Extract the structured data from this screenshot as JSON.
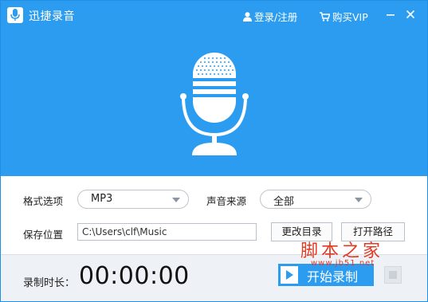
{
  "app": {
    "title": "迅捷录音"
  },
  "header": {
    "login_label": "登录/注册",
    "vip_label": "购买VIP"
  },
  "settings": {
    "format_label": "格式选项",
    "format_value": "MP3",
    "source_label": "声音来源",
    "source_value": "全部",
    "save_label": "保存位置",
    "save_path": "C:\\Users\\clf\\Music",
    "change_dir_label": "更改目录",
    "open_path_label": "打开路径"
  },
  "footer": {
    "duration_label": "录制时长：",
    "timer": "00:00:00",
    "start_label": "开始录制"
  },
  "watermark": {
    "line1": "脚本之家",
    "line2": "www.jb51.net"
  },
  "colors": {
    "accent": "#2b9cf0",
    "watermark": "#e33a24"
  }
}
